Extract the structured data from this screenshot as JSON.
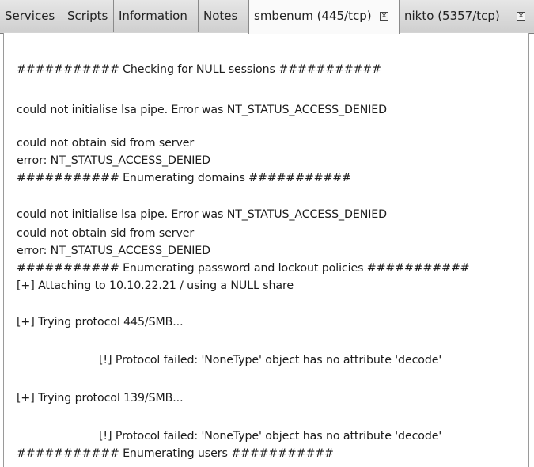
{
  "tabs": [
    {
      "label": "Services"
    },
    {
      "label": "Scripts"
    },
    {
      "label": "Information"
    },
    {
      "label": "Notes"
    },
    {
      "label": "smbenum (445/tcp)",
      "close": "⊠"
    },
    {
      "label": "nikto (5357/tcp)",
      "close": "⊠"
    }
  ],
  "output": {
    "lines": [
      "########### Checking for NULL sessions ###########",
      "could not initialise lsa pipe. Error was NT_STATUS_ACCESS_DENIED",
      "could not obtain sid from server",
      "error: NT_STATUS_ACCESS_DENIED",
      "########### Enumerating domains ###########",
      "could not initialise lsa pipe. Error was NT_STATUS_ACCESS_DENIED",
      "could not obtain sid from server",
      "error: NT_STATUS_ACCESS_DENIED",
      "########### Enumerating password and lockout policies ###########",
      "[+] Attaching to 10.10.22.21 / using a NULL share",
      "[+] Trying protocol 445/SMB...",
      "[!] Protocol failed: 'NoneType' object has no attribute 'decode'",
      "[+] Trying protocol 139/SMB...",
      "[!] Protocol failed: 'NoneType' object has no attribute 'decode'",
      "########### Enumerating users ###########"
    ]
  }
}
